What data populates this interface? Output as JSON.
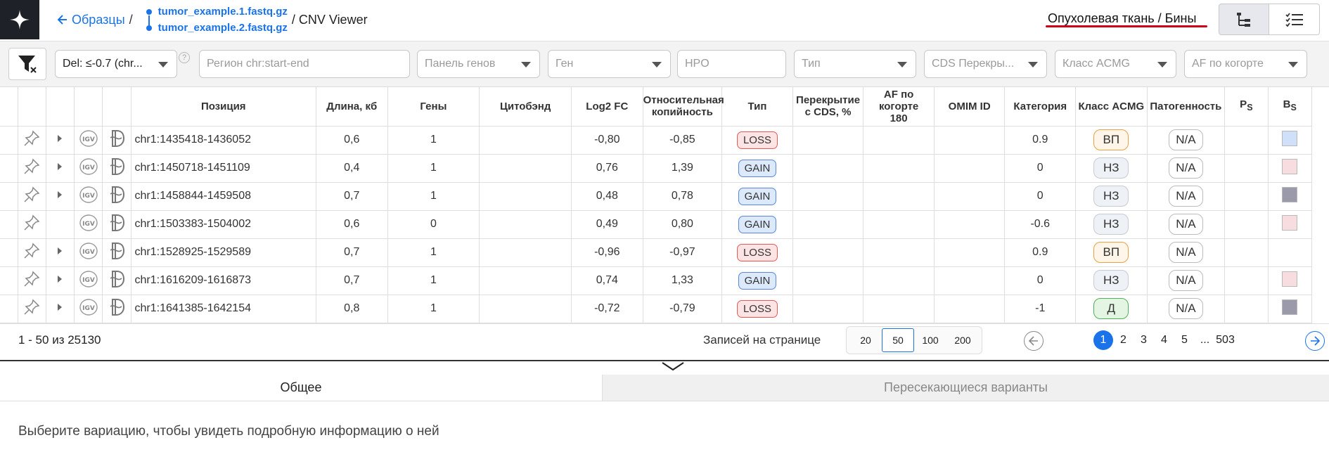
{
  "breadcrumbs": {
    "back": "Образцы",
    "sep": "/",
    "file1": "tumor_example.1.fastq.gz",
    "file2": "tumor_example.2.fastq.gz",
    "title": "/ CNV Viewer"
  },
  "view_title": "Опухолевая ткань / Бины",
  "filters": {
    "del_value": "Del: ≤-0.7 (chr...",
    "help": "?",
    "region_placeholder": "Регион chr:start-end",
    "panel_placeholder": "Панель генов",
    "gene_placeholder": "Ген",
    "hpo_placeholder": "HPO",
    "type_placeholder": "Тип",
    "cds_placeholder": "CDS Перекры...",
    "acmg_placeholder": "Класс ACMG",
    "af_placeholder": "AF по когорте"
  },
  "columns": {
    "position": "Позиция",
    "length": "Длина, кб",
    "genes": "Гены",
    "cytoband": "Цитобэнд",
    "log2fc": "Log2 FC",
    "rel1": "Относительная",
    "rel2": "копийность",
    "type": "Тип",
    "cds1": "Перекрытие",
    "cds2": "с CDS, %",
    "af1": "AF по",
    "af2": "когорте",
    "af3": "180",
    "omim": "OMIM ID",
    "category": "Категория",
    "acmg": "Класс ACMG",
    "path": "Патогенность",
    "ps_main": "P",
    "ps_sub": "S",
    "bs_main": "B",
    "bs_sub": "S"
  },
  "rows": [
    {
      "pos": "chr1:1435418-1436052",
      "len": "0,6",
      "genes": "1",
      "log2": "-0,80",
      "rel": "-0,85",
      "type": "LOSS",
      "cat": "0.9",
      "acmg": "ВП",
      "acmg_kind": "vp",
      "path": "N/A",
      "bs": "#cfe0f8",
      "expand": true
    },
    {
      "pos": "chr1:1450718-1451109",
      "len": "0,4",
      "genes": "1",
      "log2": "0,76",
      "rel": "1,39",
      "type": "GAIN",
      "cat": "0",
      "acmg": "НЗ",
      "acmg_kind": "nz",
      "path": "N/A",
      "bs": "#f8dde0",
      "expand": true
    },
    {
      "pos": "chr1:1458844-1459508",
      "len": "0,7",
      "genes": "1",
      "log2": "0,48",
      "rel": "0,78",
      "type": "GAIN",
      "cat": "0",
      "acmg": "НЗ",
      "acmg_kind": "nz",
      "path": "N/A",
      "bs": "#9a9aaa",
      "expand": true
    },
    {
      "pos": "chr1:1503383-1504002",
      "len": "0,6",
      "genes": "0",
      "log2": "0,49",
      "rel": "0,80",
      "type": "GAIN",
      "cat": "-0.6",
      "acmg": "НЗ",
      "acmg_kind": "nz",
      "path": "N/A",
      "bs": "#f8dde0",
      "expand": false
    },
    {
      "pos": "chr1:1528925-1529589",
      "len": "0,7",
      "genes": "1",
      "log2": "-0,96",
      "rel": "-0,97",
      "type": "LOSS",
      "cat": "0.9",
      "acmg": "ВП",
      "acmg_kind": "vp",
      "path": "N/A",
      "bs": "",
      "expand": true
    },
    {
      "pos": "chr1:1616209-1616873",
      "len": "0,7",
      "genes": "1",
      "log2": "0,74",
      "rel": "1,33",
      "type": "GAIN",
      "cat": "0",
      "acmg": "НЗ",
      "acmg_kind": "nz",
      "path": "N/A",
      "bs": "#f8dde0",
      "expand": true
    },
    {
      "pos": "chr1:1641385-1642154",
      "len": "0,8",
      "genes": "1",
      "log2": "-0,72",
      "rel": "-0,79",
      "type": "LOSS",
      "cat": "-1",
      "acmg": "Д",
      "acmg_kind": "d",
      "path": "N/A",
      "bs": "#9a9aaa",
      "expand": true
    }
  ],
  "footer": {
    "count": "1 - 50 из 25130",
    "perpage_label": "Записей на странице",
    "perpage": [
      "20",
      "50",
      "100",
      "200"
    ],
    "perpage_selected": "50",
    "pages": [
      "1",
      "2",
      "3",
      "4",
      "5",
      "...",
      "503"
    ],
    "current_page": "1"
  },
  "tabs": {
    "general": "Общее",
    "overlapping": "Пересекающиеся варианты"
  },
  "hint": "Выберите вариацию, чтобы увидеть подробную информацию о ней",
  "colors": {
    "accent": "#1a73e8",
    "loss": "#e25a5a",
    "gain": "#5a86d6",
    "underline": "#d0021b"
  }
}
